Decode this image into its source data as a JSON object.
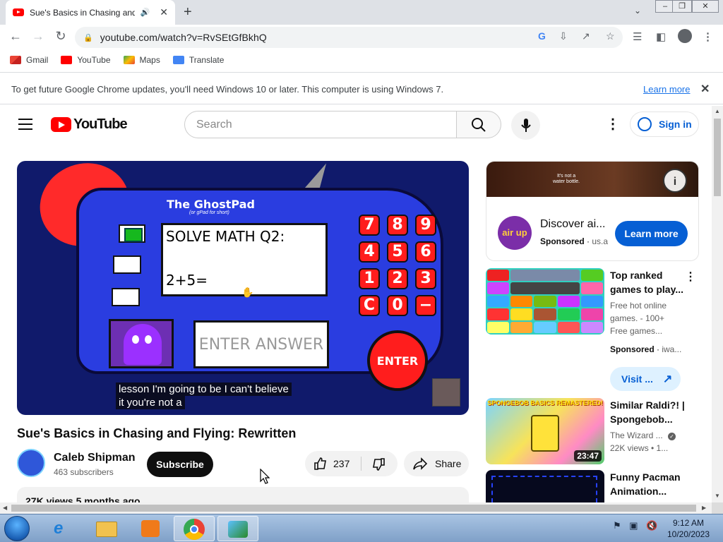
{
  "browser": {
    "tab_title": "Sue's Basics in Chasing and F",
    "tab_audio_icon": "speaker-icon",
    "url": "youtube.com/watch?v=RvSEtGfBkhQ",
    "bookmarks": [
      "Gmail",
      "YouTube",
      "Maps",
      "Translate"
    ],
    "infobar": {
      "message": "To get future Google Chrome updates, you'll need Windows 10 or later. This computer is using Windows 7.",
      "link": "Learn more"
    }
  },
  "youtube": {
    "logo_text": "YouTube",
    "search_placeholder": "Search",
    "sign_in": "Sign in",
    "video": {
      "title": "Sue's Basics in Chasing and Flying: Rewritten",
      "channel": "Caleb Shipman",
      "subscribers": "463 subscribers",
      "subscribe_label": "Subscribe",
      "likes": "237",
      "share_label": "Share",
      "views": "27K views  5 months ago",
      "caption_line1": "lesson I'm going to be I can't believe",
      "caption_line2": "it you're not a",
      "game": {
        "title": "The GhostPad",
        "subtitle": "(or gPad for short)",
        "question": "SOLVE MATH Q2:",
        "equation": "2+5=",
        "answer_placeholder": "ENTER ANSWER",
        "keys": [
          "7",
          "8",
          "9",
          "4",
          "5",
          "6",
          "1",
          "2",
          "3",
          "C",
          "0",
          "−"
        ],
        "enter_label": "ENTER"
      }
    },
    "ad": {
      "banner_text_1": "It's not a",
      "banner_text_2": "water bottle.",
      "logo_text": "air up",
      "title": "Discover ai...",
      "sponsored": "Sponsored",
      "domain": "us.a",
      "cta": "Learn more"
    },
    "recommendations": [
      {
        "title_1": "Top ranked",
        "title_2": "games to play...",
        "desc_1": "Free hot online",
        "desc_2": "games. - 100+",
        "desc_3": "Free games...",
        "sponsored": "Sponsored",
        "domain": "iwa...",
        "cta": "Visit ..."
      },
      {
        "title_1": "Similar Raldi?! |",
        "title_2": "Spongebob...",
        "channel": "The Wizard ...",
        "meta": "22K views  • 1...",
        "duration": "23:47",
        "thumb_text": "SPONGEBOB BASICS REMASTERED!"
      },
      {
        "title_1": "Funny Pacman",
        "title_2": "Animation..."
      }
    ]
  },
  "taskbar": {
    "time": "9:12 AM",
    "date": "10/20/2023"
  }
}
